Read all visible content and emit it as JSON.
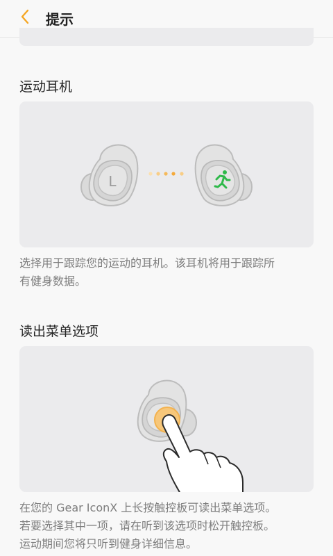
{
  "header": {
    "back_icon": "chevron-left-icon",
    "title": "提示",
    "accent_color": "#f5a623"
  },
  "sections": [
    {
      "title": "运动耳机",
      "left_earbud_label": "L",
      "right_earbud_icon": "running-person-icon",
      "description": "选择用于跟踪您的运动的耳机。该耳机将用于跟踪所\n有健身数据。"
    },
    {
      "title": "读出菜单选项",
      "illustration_icon": "finger-tap-earbud-icon",
      "description": "在您的 Gear IconX 上长按触控板可读出菜单选项。\n若要选择其中一项，请在听到该选项时松开触控板。\n运动期间您将只听到健身详细信息。"
    }
  ]
}
